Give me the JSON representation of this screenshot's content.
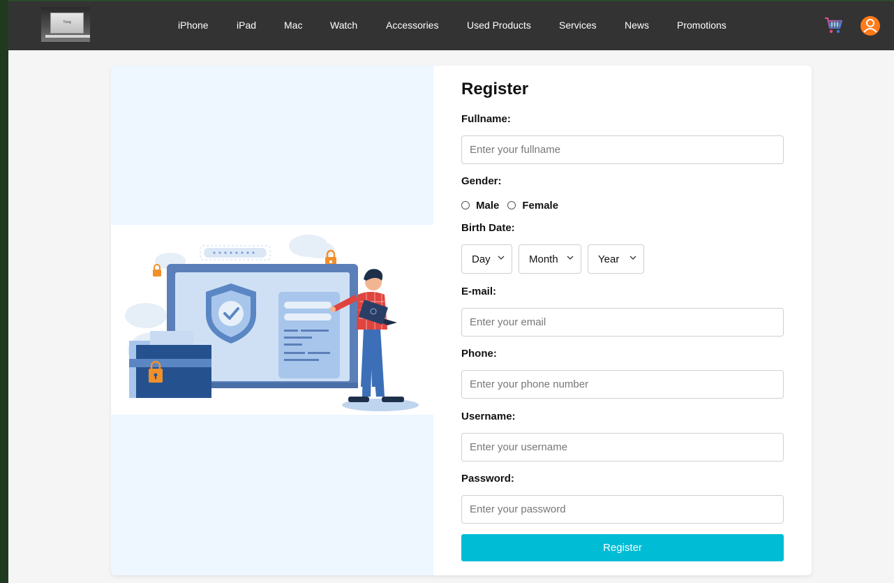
{
  "nav": {
    "logo_text": "Tung",
    "links": [
      {
        "label": "iPhone"
      },
      {
        "label": "iPad"
      },
      {
        "label": "Mac"
      },
      {
        "label": "Watch"
      },
      {
        "label": "Accessories"
      },
      {
        "label": "Used Products"
      },
      {
        "label": "Services"
      },
      {
        "label": "News"
      },
      {
        "label": "Promotions"
      }
    ],
    "cart_icon": "shopping-cart-icon",
    "user_icon": "user-avatar-icon"
  },
  "form": {
    "title": "Register",
    "fullname": {
      "label": "Fullname:",
      "placeholder": "Enter your fullname"
    },
    "gender": {
      "label": "Gender:",
      "options": [
        "Male",
        "Female"
      ]
    },
    "birthdate": {
      "label": "Birth Date:",
      "day": "Day",
      "month": "Month",
      "year": "Year"
    },
    "email": {
      "label": "E-mail:",
      "placeholder": "Enter your email"
    },
    "phone": {
      "label": "Phone:",
      "placeholder": "Enter your phone number"
    },
    "username": {
      "label": "Username:",
      "placeholder": "Enter your username"
    },
    "password": {
      "label": "Password:",
      "placeholder": "Enter your password"
    },
    "submit_label": "Register"
  },
  "colors": {
    "nav_bg": "#333333",
    "accent": "#00bcd4",
    "illustration_bg": "#eef6ff",
    "user_icon": "#ff7a1a"
  }
}
